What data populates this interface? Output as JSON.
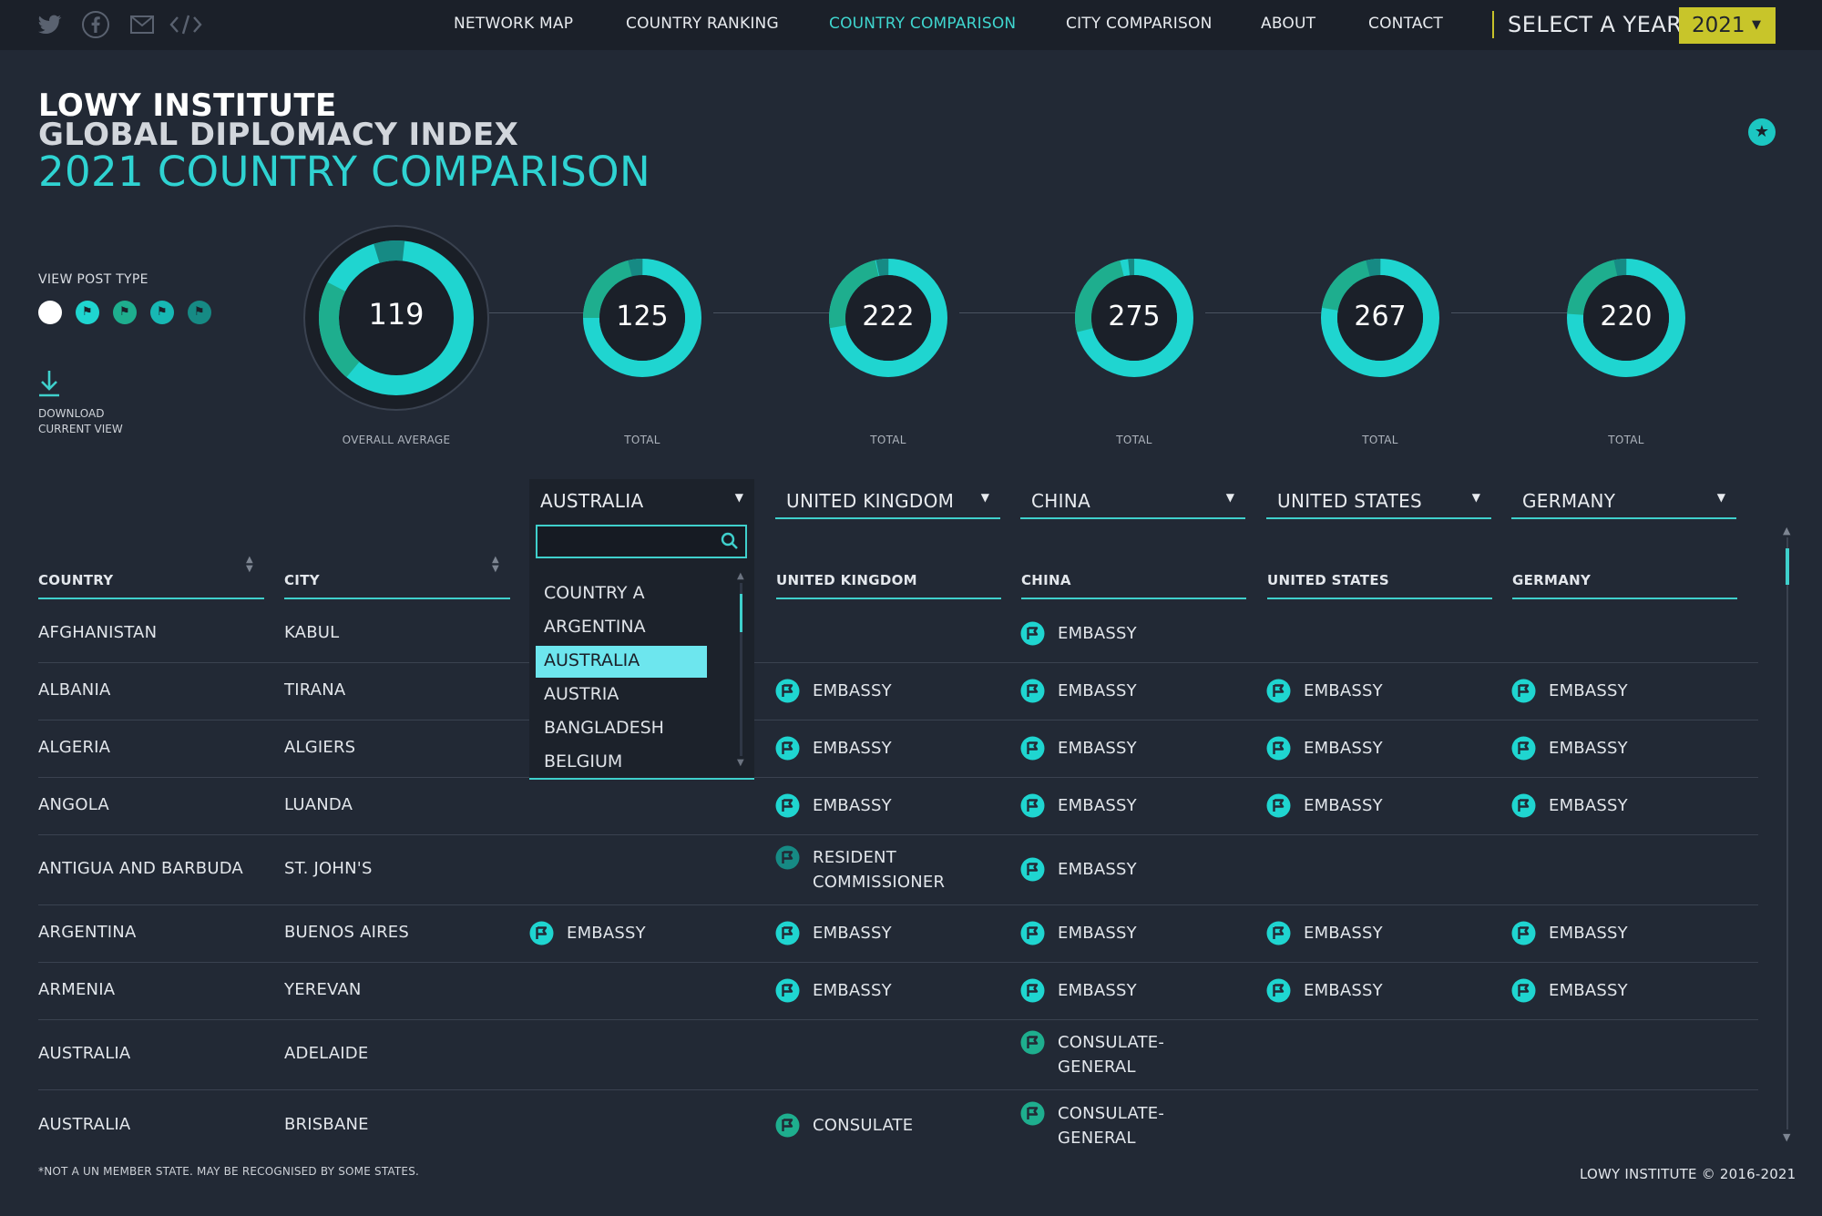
{
  "colors": {
    "background": "#222935",
    "topbar": "#1b2029",
    "accent": "#2fd3d2",
    "year_button": "#c8c52a",
    "donut_main": "#1fd5d0",
    "donut_secondary": "#1eae8e",
    "donut_dark": "#168a84"
  },
  "nav": {
    "social": [
      {
        "name": "twitter-icon"
      },
      {
        "name": "facebook-icon"
      },
      {
        "name": "mail-icon"
      },
      {
        "name": "embed-code-icon"
      }
    ],
    "items": [
      "NETWORK MAP",
      "COUNTRY RANKING",
      "COUNTRY COMPARISON",
      "CITY COMPARISON",
      "ABOUT",
      "CONTACT"
    ],
    "active": "COUNTRY COMPARISON",
    "year_label": "SELECT A YEAR",
    "year_value": "2021"
  },
  "title": {
    "line1": "LOWY INSTITUTE",
    "line2": "GLOBAL DIPLOMACY INDEX",
    "line3": "2021 COUNTRY COMPARISON"
  },
  "controls": {
    "view_post_type": "VIEW POST TYPE",
    "post_type_filters": [
      {
        "name": "all-posts",
        "color": "#ffffff"
      },
      {
        "name": "embassy",
        "color": "#1fd5d0"
      },
      {
        "name": "consulate",
        "color": "#1eae8e"
      },
      {
        "name": "permanent-mission",
        "color": "#17b8b4"
      },
      {
        "name": "other-representation",
        "color": "#168a84"
      }
    ],
    "download_label_line1": "DOWNLOAD",
    "download_label_line2": "CURRENT VIEW",
    "star_icon": "star-icon"
  },
  "donuts": [
    {
      "value": "119",
      "caption": "OVERALL AVERAGE"
    },
    {
      "value": "125",
      "caption": "TOTAL"
    },
    {
      "value": "222",
      "caption": "TOTAL"
    },
    {
      "value": "275",
      "caption": "TOTAL"
    },
    {
      "value": "267",
      "caption": "TOTAL"
    },
    {
      "value": "220",
      "caption": "TOTAL"
    }
  ],
  "country_selects": [
    "AUSTRALIA",
    "UNITED KINGDOM",
    "CHINA",
    "UNITED STATES",
    "GERMANY"
  ],
  "dropdown": {
    "search_value": "",
    "options": [
      "COUNTRY A",
      "ARGENTINA",
      "AUSTRALIA",
      "AUSTRIA",
      "BANGLADESH",
      "BELGIUM"
    ],
    "selected": "AUSTRALIA"
  },
  "table": {
    "columns": [
      "COUNTRY",
      "CITY",
      "AUSTRALIA",
      "UNITED KINGDOM",
      "CHINA",
      "UNITED STATES",
      "GERMANY"
    ],
    "rows": [
      {
        "country": "AFGHANISTAN",
        "city": "KABUL",
        "posts": [
          "",
          "",
          "EMBASSY",
          "",
          ""
        ]
      },
      {
        "country": "ALBANIA",
        "city": "TIRANA",
        "posts": [
          "",
          "EMBASSY",
          "EMBASSY",
          "EMBASSY",
          "EMBASSY"
        ]
      },
      {
        "country": "ALGERIA",
        "city": "ALGIERS",
        "posts": [
          "",
          "EMBASSY",
          "EMBASSY",
          "EMBASSY",
          "EMBASSY"
        ]
      },
      {
        "country": "ANGOLA",
        "city": "LUANDA",
        "posts": [
          "",
          "EMBASSY",
          "EMBASSY",
          "EMBASSY",
          "EMBASSY"
        ]
      },
      {
        "country": "ANTIGUA AND BARBUDA",
        "city": "ST. JOHN'S",
        "posts": [
          "",
          "RESIDENT COMMISSIONER",
          "EMBASSY",
          "",
          ""
        ]
      },
      {
        "country": "ARGENTINA",
        "city": "BUENOS AIRES",
        "posts": [
          "EMBASSY",
          "EMBASSY",
          "EMBASSY",
          "EMBASSY",
          "EMBASSY"
        ]
      },
      {
        "country": "ARMENIA",
        "city": "YEREVAN",
        "posts": [
          "",
          "EMBASSY",
          "EMBASSY",
          "EMBASSY",
          "EMBASSY"
        ]
      },
      {
        "country": "AUSTRALIA",
        "city": "ADELAIDE",
        "posts": [
          "",
          "",
          "CONSULATE-GENERAL",
          "",
          ""
        ]
      },
      {
        "country": "AUSTRALIA",
        "city": "BRISBANE",
        "posts": [
          "",
          "CONSULATE",
          "CONSULATE-GENERAL",
          "",
          ""
        ]
      }
    ]
  },
  "footnote": "*NOT A UN MEMBER STATE. MAY BE RECOGNISED BY SOME STATES.",
  "copyright": "LOWY INSTITUTE © 2016-2021"
}
